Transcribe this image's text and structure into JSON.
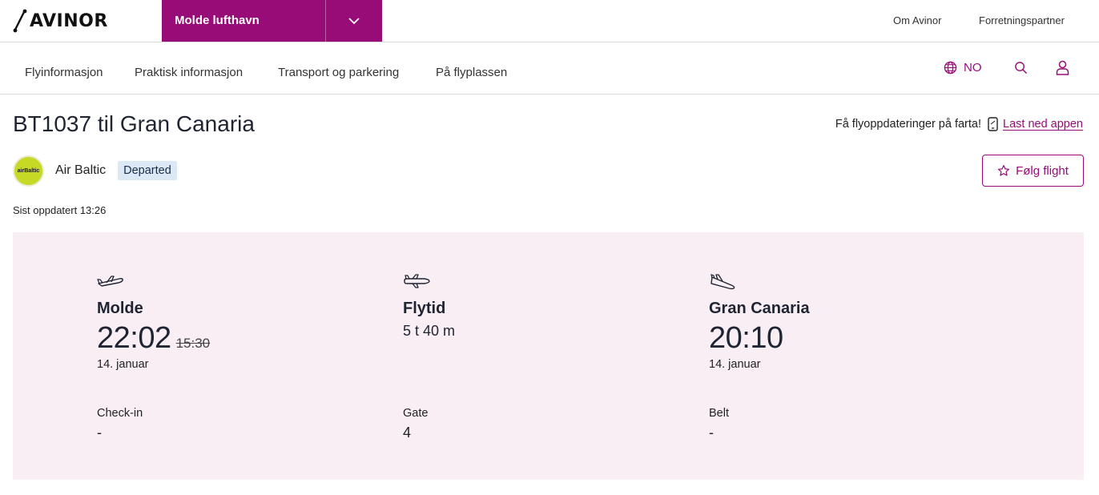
{
  "brand": {
    "logo_text": "AVINOR"
  },
  "airport_selector": {
    "selected": "Molde lufthavn"
  },
  "top_links": {
    "about": "Om Avinor",
    "business": "Forretningspartner"
  },
  "nav": {
    "items": [
      "Flyinformasjon",
      "Praktisk informasjon",
      "Transport og parkering",
      "På flyplassen"
    ],
    "language": "NO"
  },
  "flight": {
    "title": "BT1037 til Gran Canaria",
    "airline": "Air Baltic",
    "airline_logo_text": "airBaltic",
    "status": "Departed",
    "follow_label": "Følg flight",
    "last_updated": "Sist oppdatert 13:26"
  },
  "app_promo": {
    "text": "Få flyoppdateringer på farta!",
    "link": "Last ned appen"
  },
  "details": {
    "departure": {
      "place": "Molde",
      "time": "22:02",
      "scheduled_time": "15:30",
      "date": "14. januar",
      "label": "Check-in",
      "value": "-"
    },
    "duration": {
      "place": "Flytid",
      "value_text": "5 t 40 m",
      "label": "Gate",
      "value": "4"
    },
    "arrival": {
      "place": "Gran Canaria",
      "time": "20:10",
      "date": "14. januar",
      "label": "Belt",
      "value": "-"
    }
  },
  "colors": {
    "brand": "#980c77",
    "panel": "#f8eef4",
    "badge": "#dbe9f7"
  }
}
